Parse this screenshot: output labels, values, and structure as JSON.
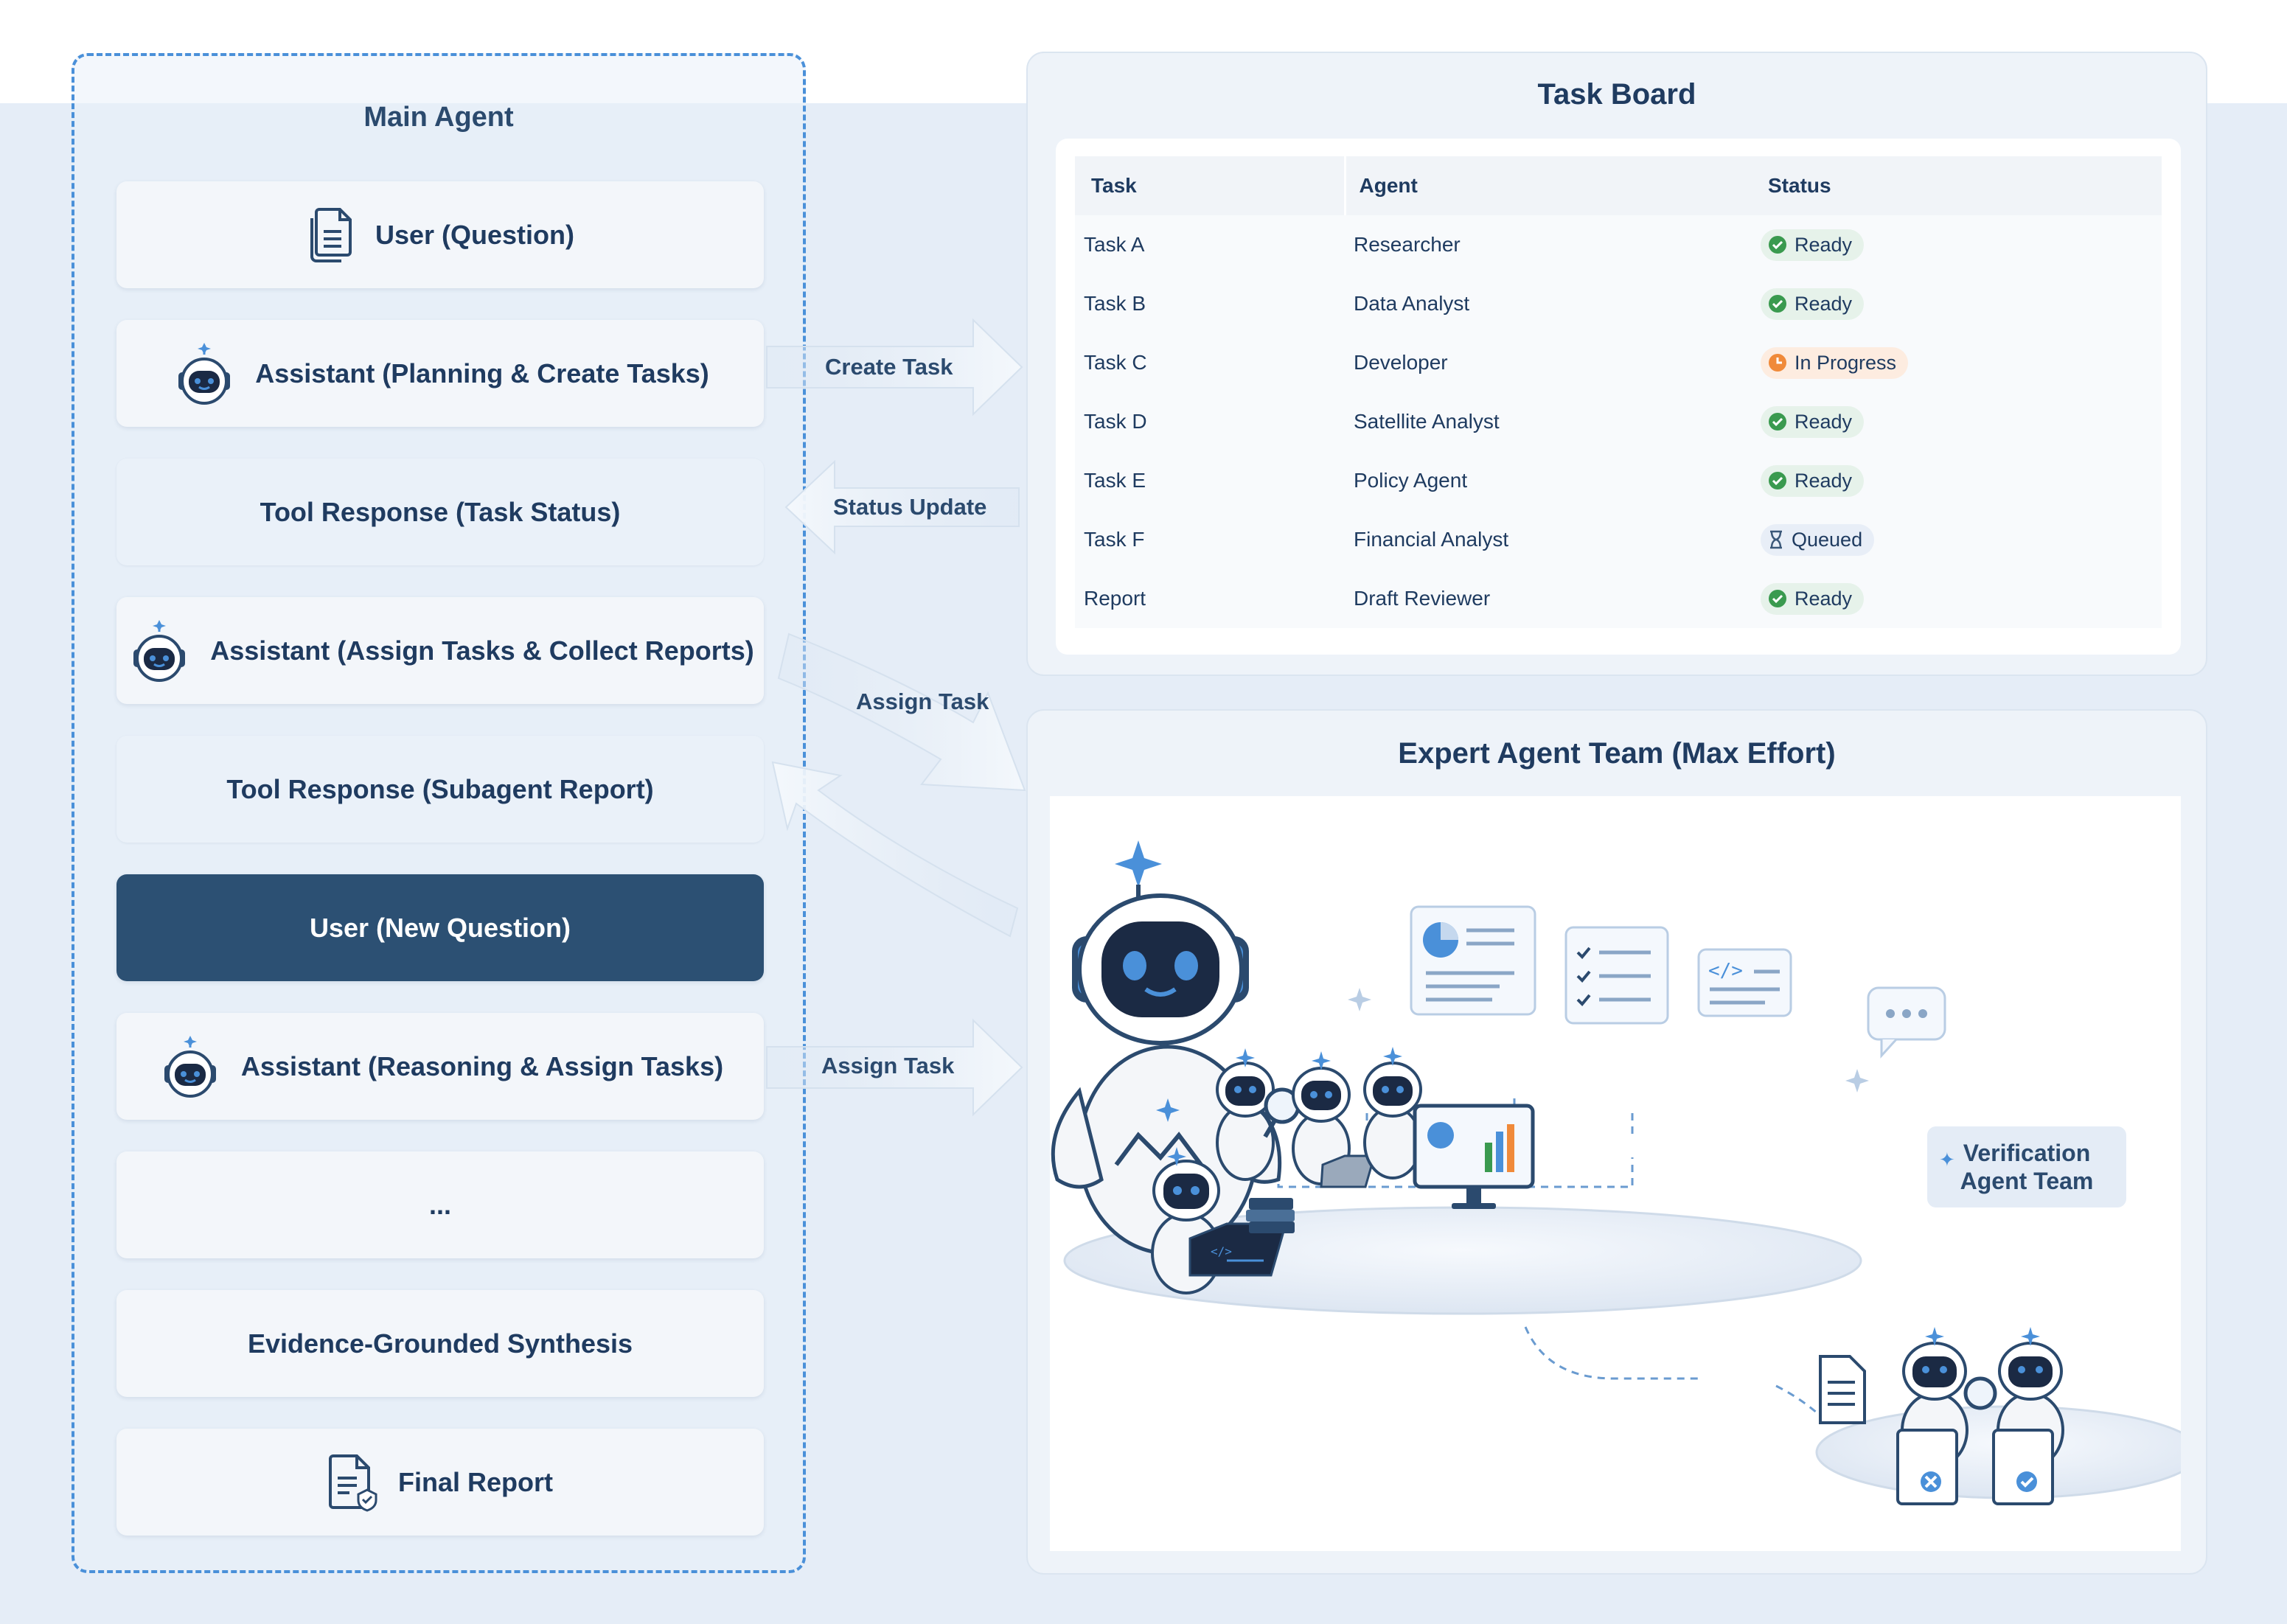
{
  "main_agent": {
    "title": "Main Agent",
    "steps": [
      {
        "label": "User (Question)",
        "icon": "documents-icon"
      },
      {
        "label": "Assistant (Planning & Create Tasks)",
        "icon": "robot-icon"
      },
      {
        "label": "Tool Response (Task Status)",
        "icon": ""
      },
      {
        "label": "Assistant (Assign Tasks & Collect Reports)",
        "icon": "robot-icon"
      },
      {
        "label": "Tool Response (Subagent Report)",
        "icon": ""
      },
      {
        "label": "User (New Question)",
        "icon": ""
      },
      {
        "label": "Assistant (Reasoning & Assign Tasks)",
        "icon": "robot-icon"
      },
      {
        "label": "...",
        "icon": ""
      },
      {
        "label": "Evidence-Grounded Synthesis",
        "icon": ""
      },
      {
        "label": "Final Report",
        "icon": "report-check-icon"
      }
    ]
  },
  "arrows": {
    "create_task": "Create Task",
    "status_update": "Status Update",
    "assign_task_1": "Assign Task",
    "assign_task_2": "Assign Task"
  },
  "task_board": {
    "title": "Task Board",
    "columns": [
      "Task",
      "Agent",
      "Status"
    ],
    "rows": [
      {
        "task": "Task A",
        "agent": "Researcher",
        "status": "Ready",
        "status_type": "ready"
      },
      {
        "task": "Task B",
        "agent": "Data Analyst",
        "status": "Ready",
        "status_type": "ready"
      },
      {
        "task": "Task C",
        "agent": "Developer",
        "status": "In Progress",
        "status_type": "progress"
      },
      {
        "task": "Task D",
        "agent": "Satellite Analyst",
        "status": "Ready",
        "status_type": "ready"
      },
      {
        "task": "Task E",
        "agent": "Policy Agent",
        "status": "Ready",
        "status_type": "ready"
      },
      {
        "task": "Task F",
        "agent": "Financial Analyst",
        "status": "Queued",
        "status_type": "queued"
      },
      {
        "task": "Report",
        "agent": "Draft Reviewer",
        "status": "Ready",
        "status_type": "ready"
      }
    ]
  },
  "expert_team": {
    "title": "Expert Agent Team (Max Effort)",
    "verification_label_line1": "Verification",
    "verification_label_line2": "Agent Team"
  },
  "colors": {
    "accent": "#4a90d9",
    "dark_step": "#2c5073",
    "ready": "#3a9a4f",
    "progress": "#f08a3a",
    "queued": "#5a7596"
  }
}
